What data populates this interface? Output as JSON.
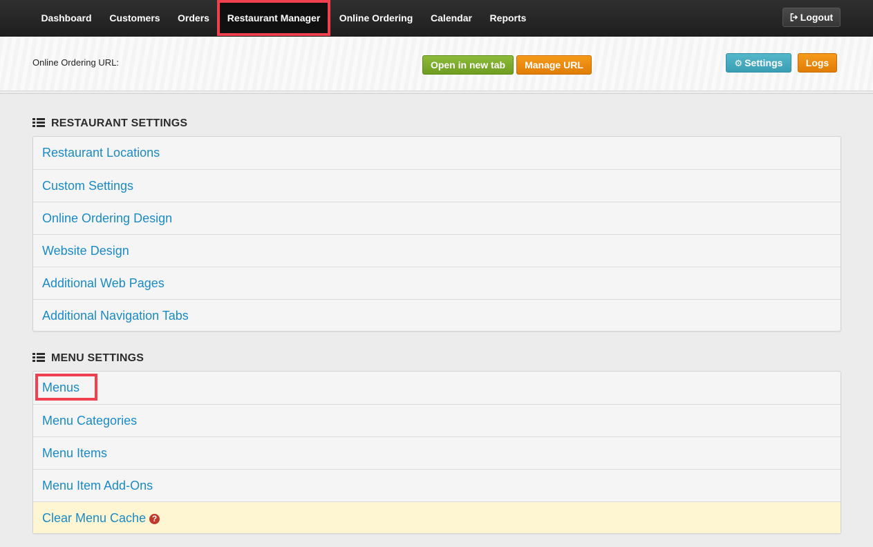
{
  "navbar": {
    "items": [
      {
        "label": "Dashboard"
      },
      {
        "label": "Customers"
      },
      {
        "label": "Orders"
      },
      {
        "label": "Restaurant Manager",
        "active": true
      },
      {
        "label": "Online Ordering"
      },
      {
        "label": "Calendar"
      },
      {
        "label": "Reports"
      }
    ],
    "logout_label": "Logout",
    "logout_icon": "sign-out-icon"
  },
  "url_bar": {
    "label": "Online Ordering URL:",
    "open_tab_label": "Open in new tab",
    "manage_url_label": "Manage URL",
    "settings_label": "Settings",
    "settings_icon": "gear-icon",
    "logs_label": "Logs"
  },
  "restaurant_settings": {
    "heading": "RESTAURANT SETTINGS",
    "items": [
      {
        "label": "Restaurant Locations"
      },
      {
        "label": "Custom Settings"
      },
      {
        "label": "Online Ordering Design"
      },
      {
        "label": "Website Design"
      },
      {
        "label": "Additional Web Pages"
      },
      {
        "label": "Additional Navigation Tabs"
      }
    ]
  },
  "menu_settings": {
    "heading": "MENU SETTINGS",
    "items": [
      {
        "label": "Menus",
        "highlighted": true
      },
      {
        "label": "Menu Categories"
      },
      {
        "label": "Menu Items"
      },
      {
        "label": "Menu Item Add-Ons"
      },
      {
        "label": "Clear Menu Cache",
        "warning": true,
        "help_icon": "question-circle-icon"
      }
    ]
  },
  "colors": {
    "navbar_bg": "#2a2a2a",
    "link": "#1a8ac6",
    "highlight": "#f04050",
    "green": "#7aab2c",
    "orange": "#ee8a0c",
    "teal": "#48aabf",
    "warning_row": "#fef6d2"
  }
}
